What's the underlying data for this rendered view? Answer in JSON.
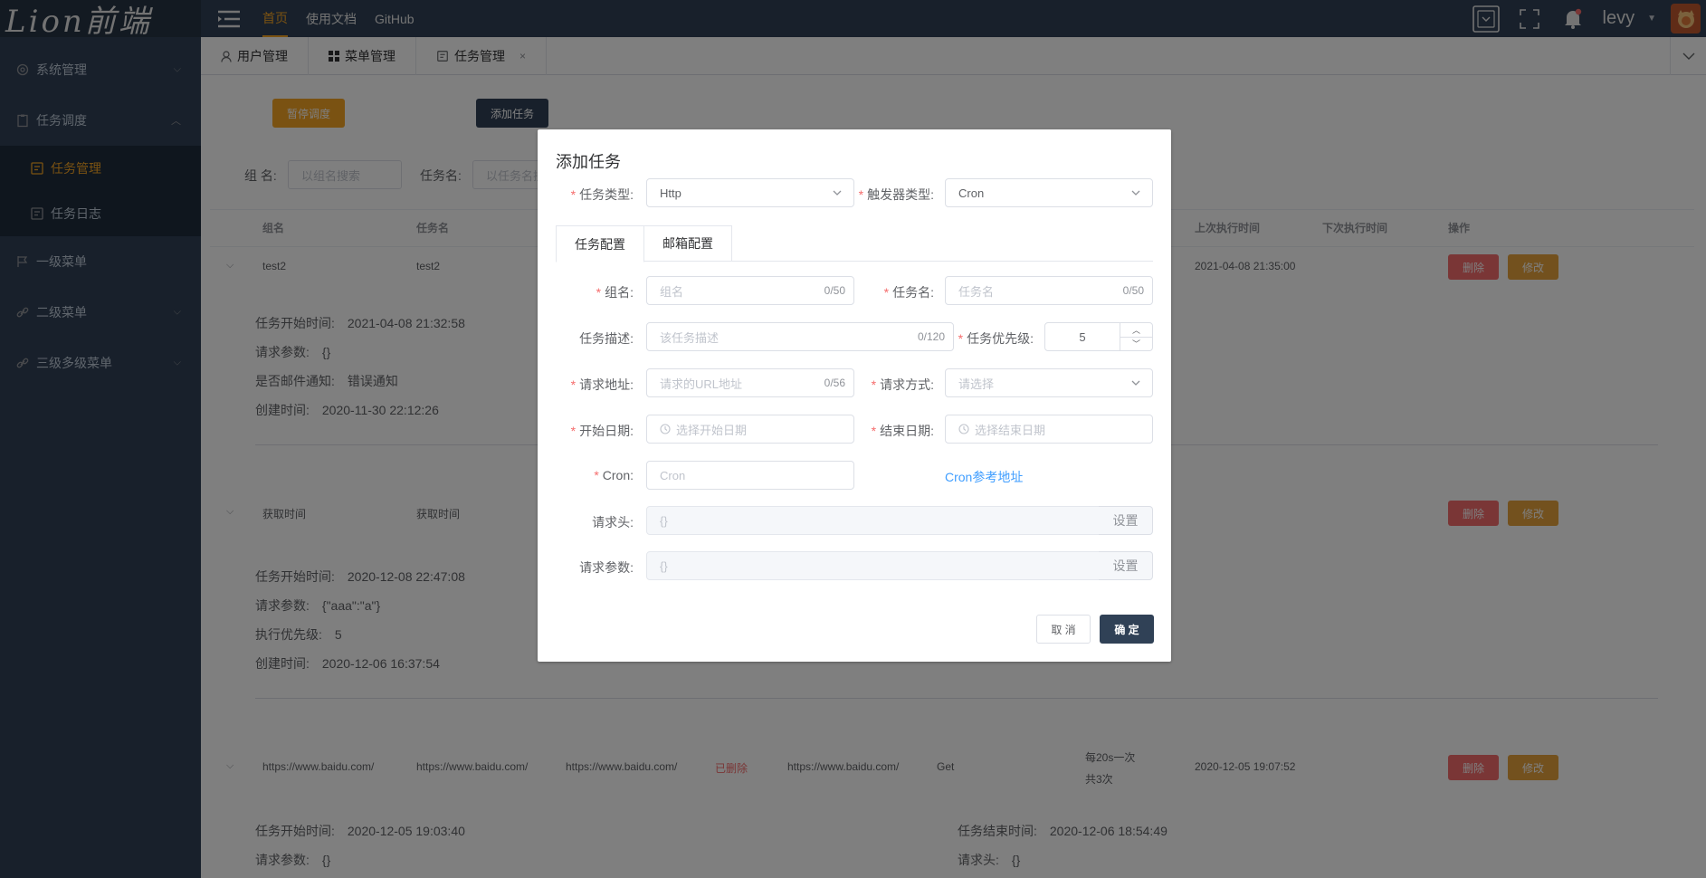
{
  "logo_text": "Lion前端",
  "sidebar": {
    "items": [
      {
        "label": "系统管理",
        "icon": "gear-icon"
      },
      {
        "label": "任务调度",
        "icon": "clipboard-icon"
      },
      {
        "label": "一级菜单",
        "icon": "flag-icon"
      },
      {
        "label": "二级菜单",
        "icon": "link-icon"
      },
      {
        "label": "三级多级菜单",
        "icon": "link-icon"
      }
    ],
    "sub_items": [
      {
        "label": "任务管理",
        "icon": "task-icon"
      },
      {
        "label": "任务日志",
        "icon": "log-icon"
      }
    ]
  },
  "topnav": {
    "links": [
      "首页",
      "使用文档",
      "GitHub"
    ],
    "username": "levy"
  },
  "tags": [
    {
      "label": "用户管理",
      "icon": "user-icon"
    },
    {
      "label": "菜单管理",
      "icon": "grid-icon"
    },
    {
      "label": "任务管理",
      "icon": "task-icon",
      "close": "×"
    }
  ],
  "toolbar": {
    "pause_label": "暂停调度",
    "add_label": "添加任务"
  },
  "search": {
    "group_label": "组 名:",
    "group_placeholder": "以组名搜索",
    "task_label": "任务名:",
    "task_placeholder": "以任务名搜索"
  },
  "table": {
    "headers": [
      "组名",
      "任务名",
      "上次执行时间",
      "下次执行时间",
      "操作"
    ],
    "delete_label": "删除",
    "edit_label": "修改",
    "rows": [
      {
        "group": "test2",
        "task": "test2",
        "last_run": "2021-04-08 21:35:00",
        "details": [
          [
            "任务开始时间:",
            "2021-04-08 21:32:58"
          ],
          [
            "请求参数:",
            "{}"
          ],
          [
            "是否邮件通知:",
            "错误通知"
          ],
          [
            "创建时间:",
            "2020-11-30 22:12:26"
          ]
        ]
      },
      {
        "group": "获取时间",
        "task": "获取时间",
        "details": [
          [
            "任务开始时间:",
            "2020-12-08 22:47:08"
          ],
          [
            "请求参数:",
            "{\"aaa\":\"a\"}"
          ],
          [
            "执行优先级:",
            "5"
          ],
          [
            "创建时间:",
            "2020-12-06 16:37:54"
          ]
        ]
      },
      {
        "group": "https://www.baidu.com/",
        "task": "https://www.baidu.com/",
        "desc": "https://www.baidu.com/",
        "status": "已删除",
        "url": "https://www.baidu.com/",
        "method": "Get",
        "cron_desc_1": "每20s一次",
        "cron_desc_2": "共3次",
        "last_run": "2020-12-05 19:07:52",
        "details_left": [
          [
            "任务开始时间:",
            "2020-12-05 19:03:40"
          ],
          [
            "请求参数:",
            "{}"
          ]
        ],
        "details_right": [
          [
            "任务结束时间:",
            "2020-12-06 18:54:49"
          ],
          [
            "请求头:",
            "{}"
          ]
        ]
      }
    ]
  },
  "dialog": {
    "title": "添加任务",
    "task_type": {
      "label": "任务类型:",
      "value": "Http"
    },
    "trigger_type": {
      "label": "触发器类型:",
      "value": "Cron"
    },
    "tabs": [
      "任务配置",
      "邮箱配置"
    ],
    "group": {
      "label": "组名:",
      "placeholder": "组名",
      "count": "0/50"
    },
    "task_name": {
      "label": "任务名:",
      "placeholder": "任务名",
      "count": "0/50"
    },
    "desc": {
      "label": "任务描述:",
      "placeholder": "该任务描述",
      "count": "0/120"
    },
    "priority": {
      "label": "任务优先级:",
      "value": "5"
    },
    "url": {
      "label": "请求地址:",
      "placeholder": "请求的URL地址",
      "count": "0/56"
    },
    "method": {
      "label": "请求方式:",
      "placeholder": "请选择"
    },
    "start_date": {
      "label": "开始日期:",
      "placeholder": "选择开始日期"
    },
    "end_date": {
      "label": "结束日期:",
      "placeholder": "选择结束日期"
    },
    "cron": {
      "label": "Cron:",
      "placeholder": "Cron",
      "link": "Cron参考地址"
    },
    "headers": {
      "label": "请求头:",
      "value": "{}",
      "btn": "设置"
    },
    "params": {
      "label": "请求参数:",
      "value": "{}",
      "btn": "设置"
    },
    "cancel": "取 消",
    "confirm": "确 定"
  },
  "colors": {
    "accent": "#f4a425",
    "sidebar_bg": "#304156",
    "danger": "#f56c6c",
    "link": "#409eff"
  }
}
